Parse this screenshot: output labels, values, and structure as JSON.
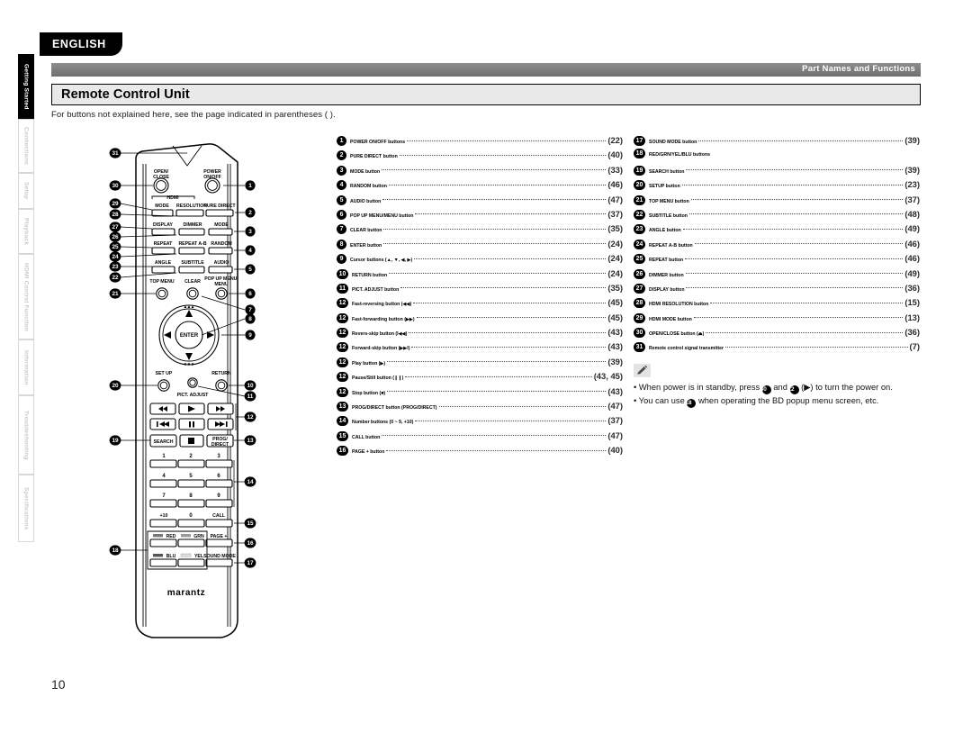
{
  "language_tab": "ENGLISH",
  "header": {
    "section_label": "Part Names and Functions",
    "title": "Remote Control Unit",
    "subtitle": "For buttons not explained here, see the page indicated in parentheses ( )."
  },
  "page_number": "10",
  "sidebar": {
    "items": [
      {
        "label": "Getting Started",
        "active": true
      },
      {
        "label": "Connections",
        "active": false
      },
      {
        "label": "Setup",
        "active": false
      },
      {
        "label": "Playback",
        "active": false
      },
      {
        "label": "HDMI Control Function",
        "active": false
      },
      {
        "label": "Information",
        "active": false
      },
      {
        "label": "Troubleshooting",
        "active": false
      },
      {
        "label": "Specifications",
        "active": false
      }
    ]
  },
  "list_middle": [
    {
      "num": "1",
      "label": "POWER ON/OFF buttons",
      "page": "(22)"
    },
    {
      "num": "2",
      "label": "PURE DIRECT button",
      "page": "(40)"
    },
    {
      "num": "3",
      "label": "MODE button",
      "page": "(33)"
    },
    {
      "num": "4",
      "label": "RANDOM button",
      "page": "(46)"
    },
    {
      "num": "5",
      "label": "AUDIO button",
      "page": "(47)"
    },
    {
      "num": "6",
      "label": "POP UP MENU/MENU button",
      "page": "(37)"
    },
    {
      "num": "7",
      "label": "CLEAR button",
      "page": "(35)"
    },
    {
      "num": "8",
      "label": "ENTER button",
      "page": "(24)"
    },
    {
      "num": "9",
      "label": "Cursor buttons (▲, ▼, ◀, ▶)",
      "page": "(24)"
    },
    {
      "num": "10",
      "label": "RETURN button",
      "page": "(24)"
    },
    {
      "num": "11",
      "label": "PICT. ADJUST button",
      "page": "(35)"
    },
    {
      "num": "12",
      "label": "Fast-reversing button (◀◀)",
      "page": "(45)"
    },
    {
      "num": "12",
      "label": "Fast-forwarding button (▶▶)",
      "page": "(45)"
    },
    {
      "num": "12",
      "label": "Revers-skip button (I◀◀)",
      "page": "(43)"
    },
    {
      "num": "12",
      "label": "Forward-skip button (▶▶I)",
      "page": "(43)"
    },
    {
      "num": "12",
      "label": "Play button (▶)",
      "page": "(39)"
    },
    {
      "num": "12",
      "label": "Pause/Still button (❙❙)",
      "page": "(43, 45)"
    },
    {
      "num": "12",
      "label": "Stop button (■)",
      "page": "(43)"
    },
    {
      "num": "13",
      "label": "PROG/DIRECT button (PROG/DIRECT)",
      "page": "(47)"
    },
    {
      "num": "14",
      "label": "Number buttons (0 ~ 9, +10)",
      "page": "(37)"
    },
    {
      "num": "15",
      "label": "CALL button",
      "page": "(47)"
    },
    {
      "num": "16",
      "label": "PAGE + button",
      "page": "(40)"
    }
  ],
  "list_right": [
    {
      "num": "17",
      "label": "SOUND MODE button",
      "page": "(39)"
    },
    {
      "num": "18",
      "label": "RED/GRN/YEL/BLU buttons",
      "page": ""
    },
    {
      "num": "19",
      "label": "SEARCH button",
      "page": "(39)"
    },
    {
      "num": "20",
      "label": "SETUP button",
      "page": "(23)"
    },
    {
      "num": "21",
      "label": "TOP MENU button",
      "page": "(37)"
    },
    {
      "num": "22",
      "label": "SUBTITLE button",
      "page": "(48)"
    },
    {
      "num": "23",
      "label": "ANGLE button",
      "page": "(49)"
    },
    {
      "num": "24",
      "label": "REPEAT A-B button",
      "page": "(46)"
    },
    {
      "num": "25",
      "label": "REPEAT button",
      "page": "(46)"
    },
    {
      "num": "26",
      "label": "DIMMER button",
      "page": "(49)"
    },
    {
      "num": "27",
      "label": "DISPLAY button",
      "page": "(36)"
    },
    {
      "num": "28",
      "label": "HDMI RESOLUTION button",
      "page": "(15)"
    },
    {
      "num": "29",
      "label": "HDMI MODE button",
      "page": "(13)"
    },
    {
      "num": "30",
      "label": "OPEN/CLOSE button (⏏)",
      "page": "(36)"
    },
    {
      "num": "31",
      "label": "Remote control signal transmitter",
      "page": "(7)"
    }
  ],
  "note": {
    "icon": "pencil-icon",
    "lines": [
      {
        "pre": "When power is in standby, press ",
        "n1": "30",
        "mid": " and ",
        "n2": "12",
        "post": " (▶) to turn the power on."
      },
      {
        "pre": "You can use ",
        "n1": "18",
        "mid": "",
        "n2": "",
        "post": " when operating the BD popup menu screen, etc."
      }
    ]
  },
  "remote": {
    "brand": "marantz",
    "labels": {
      "open_close": "OPEN/\nCLOSE",
      "power": "POWER\nON/OFF",
      "hdmi_group": "HDMI",
      "hdmi_mode": "MODE",
      "hdmi_resolution": "RESOLUTION",
      "pure_direct": "PURE DIRECT",
      "display": "DISPLAY",
      "dimmer": "DIMMER",
      "mode": "MODE",
      "repeat": "REPEAT",
      "repeat_ab": "REPEAT A-B",
      "random": "RANDOM",
      "angle": "ANGLE",
      "subtitle": "SUBTITLE",
      "audio": "AUDIO",
      "top_menu": "TOP MENU",
      "clear": "CLEAR",
      "popup_menu": "POP UP MENU/\nMENU",
      "enter": "ENTER",
      "setup": "SET UP",
      "return": "RETURN",
      "pict_adjust": "PICT. ADJUST",
      "search": "SEARCH",
      "prog_direct": "PROG/\nDIRECT",
      "plus10": "+10",
      "zero": "0",
      "call": "CALL",
      "page_plus": "PAGE +",
      "red": "RED",
      "grn": "GRN",
      "blu": "BLU",
      "yel": "YEL",
      "sound_mode": "SOUND MODE",
      "numbers": [
        "1",
        "2",
        "3",
        "4",
        "5",
        "6",
        "7",
        "8",
        "9"
      ]
    },
    "callouts_left": [
      "31",
      "30",
      "29",
      "28",
      "27",
      "26",
      "25",
      "24",
      "23",
      "22",
      "21",
      "20",
      "19",
      "18"
    ],
    "callouts_right": [
      "1",
      "2",
      "3",
      "4",
      "5",
      "6",
      "7",
      "8",
      "9",
      "10",
      "11",
      "12",
      "13",
      "14",
      "15",
      "16",
      "17"
    ]
  }
}
